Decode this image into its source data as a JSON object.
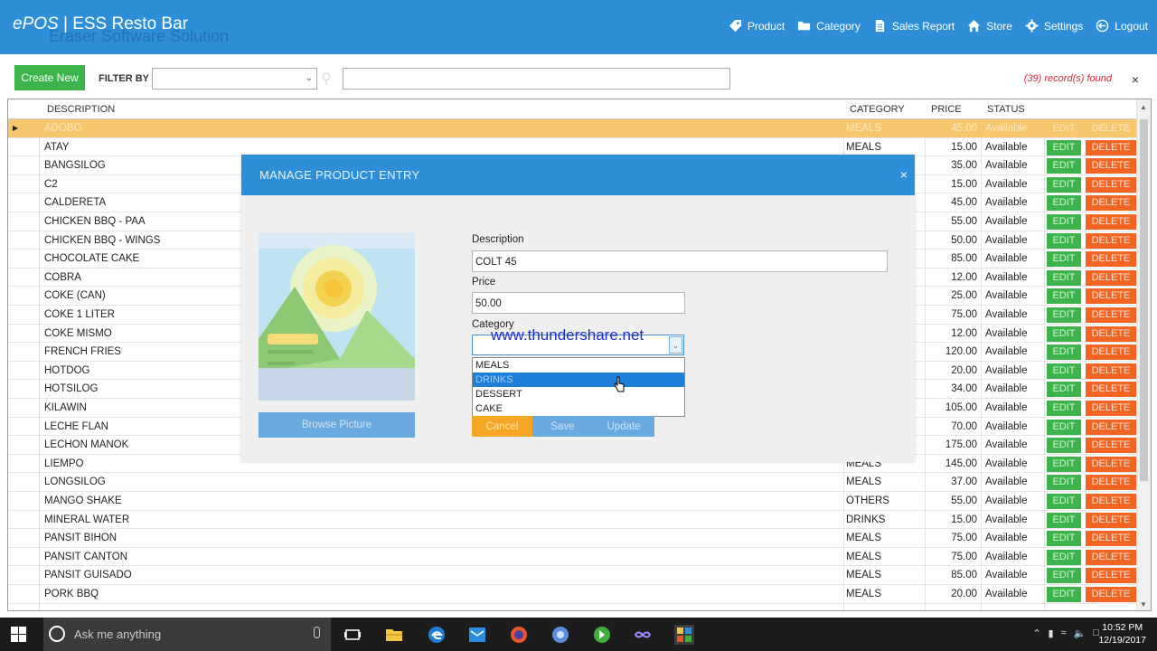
{
  "app": {
    "logo_epos": "ePOS",
    "logo_sep": " | ",
    "logo_name": "ESS Resto Bar",
    "subtitle": "Eraser Software Solution"
  },
  "nav": [
    {
      "label": "Product",
      "icon": "tag-icon"
    },
    {
      "label": "Category",
      "icon": "folder-icon"
    },
    {
      "label": "Sales Report",
      "icon": "document-icon"
    },
    {
      "label": "Store",
      "icon": "home-icon"
    },
    {
      "label": "Settings",
      "icon": "gear-icon"
    },
    {
      "label": "Logout",
      "icon": "logout-icon"
    }
  ],
  "toolbar": {
    "create_label": "Create New",
    "filter_label": "FILTER BY",
    "filter_value": "",
    "search_value": "",
    "records_found": "(39) record(s) found",
    "close_symbol": "×"
  },
  "grid": {
    "columns": [
      "DESCRIPTION",
      "CATEGORY",
      "PRICE",
      "STATUS"
    ],
    "edit_label": "EDIT",
    "delete_label": "DELETE",
    "rows": [
      {
        "desc": "ADOBO",
        "cat": "MEALS",
        "price": "45.00",
        "status": "Available"
      },
      {
        "desc": "ATAY",
        "cat": "MEALS",
        "price": "15.00",
        "status": "Available"
      },
      {
        "desc": "BANGSILOG",
        "cat": "",
        "price": "35.00",
        "status": "Available"
      },
      {
        "desc": "C2",
        "cat": "",
        "price": "15.00",
        "status": "Available"
      },
      {
        "desc": "CALDERETA",
        "cat": "",
        "price": "45.00",
        "status": "Available"
      },
      {
        "desc": "CHICKEN BBQ - PAA",
        "cat": "",
        "price": "55.00",
        "status": "Available"
      },
      {
        "desc": "CHICKEN BBQ - WINGS",
        "cat": "",
        "price": "50.00",
        "status": "Available"
      },
      {
        "desc": "CHOCOLATE CAKE",
        "cat": "",
        "price": "85.00",
        "status": "Available"
      },
      {
        "desc": "COBRA",
        "cat": "",
        "price": "12.00",
        "status": "Available"
      },
      {
        "desc": "COKE (CAN)",
        "cat": "",
        "price": "25.00",
        "status": "Available"
      },
      {
        "desc": "COKE 1 LITER",
        "cat": "",
        "price": "75.00",
        "status": "Available"
      },
      {
        "desc": "COKE MISMO",
        "cat": "",
        "price": "12.00",
        "status": "Available"
      },
      {
        "desc": "FRENCH FRIES",
        "cat": "",
        "price": "120.00",
        "status": "Available"
      },
      {
        "desc": "HOTDOG",
        "cat": "",
        "price": "20.00",
        "status": "Available"
      },
      {
        "desc": "HOTSILOG",
        "cat": "",
        "price": "34.00",
        "status": "Available"
      },
      {
        "desc": "KILAWIN",
        "cat": "",
        "price": "105.00",
        "status": "Available"
      },
      {
        "desc": "LECHE FLAN",
        "cat": "",
        "price": "70.00",
        "status": "Available"
      },
      {
        "desc": "LECHON MANOK",
        "cat": "",
        "price": "175.00",
        "status": "Available"
      },
      {
        "desc": "LIEMPO",
        "cat": "MEALS",
        "price": "145.00",
        "status": "Available"
      },
      {
        "desc": "LONGSILOG",
        "cat": "MEALS",
        "price": "37.00",
        "status": "Available"
      },
      {
        "desc": "MANGO SHAKE",
        "cat": "OTHERS",
        "price": "55.00",
        "status": "Available"
      },
      {
        "desc": "MINERAL WATER",
        "cat": "DRINKS",
        "price": "15.00",
        "status": "Available"
      },
      {
        "desc": "PANSIT BIHON",
        "cat": "MEALS",
        "price": "75.00",
        "status": "Available"
      },
      {
        "desc": "PANSIT CANTON",
        "cat": "MEALS",
        "price": "75.00",
        "status": "Available"
      },
      {
        "desc": "PANSIT GUISADO",
        "cat": "MEALS",
        "price": "85.00",
        "status": "Available"
      },
      {
        "desc": "PORK BBQ",
        "cat": "MEALS",
        "price": "20.00",
        "status": "Available"
      }
    ]
  },
  "modal": {
    "title": "MANAGE PRODUCT ENTRY",
    "close_symbol": "×",
    "browse_label": "Browse Picture",
    "description_label": "Description",
    "description_value": "COLT 45",
    "price_label": "Price",
    "price_value": "50.00",
    "category_label": "Category",
    "category_options": [
      "MEALS",
      "DRINKS",
      "DESSERT",
      "CAKE"
    ],
    "highlighted_option": "DRINKS",
    "cancel_label": "Cancel",
    "save_label": "Save",
    "update_label": "Update"
  },
  "watermark": "www.thundershare.net",
  "taskbar": {
    "search_placeholder": "Ask me anything",
    "time": "10:52 PM",
    "date": "12/19/2017"
  },
  "colors": {
    "header_blue": "#2e8fd8",
    "green": "#3cb44b",
    "orange": "#f26522",
    "selected_row": "#f6c76d"
  }
}
